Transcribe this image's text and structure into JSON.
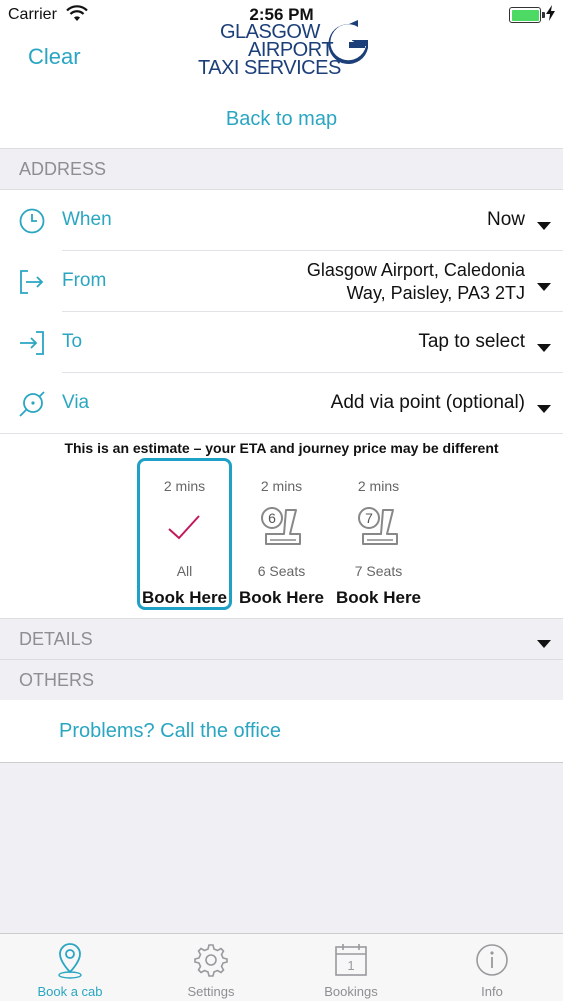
{
  "status_bar": {
    "carrier": "Carrier",
    "time": "2:56 PM"
  },
  "header": {
    "clear_label": "Clear",
    "logo": {
      "line1": "GLASGOW",
      "line2": "AIRPORT",
      "line3": "TAXI SERVICES"
    }
  },
  "back_to_map": "Back to map",
  "sections": {
    "address": "ADDRESS",
    "details": "DETAILS",
    "others": "OTHERS"
  },
  "address_rows": [
    {
      "label": "When",
      "value": "Now",
      "icon": "clock-icon"
    },
    {
      "label": "From",
      "value_line1": "Glasgow Airport, Caledonia",
      "value_line2": "Way, Paisley, PA3 2TJ",
      "icon": "from-icon"
    },
    {
      "label": "To",
      "value": "Tap to select",
      "icon": "to-icon"
    },
    {
      "label": "Via",
      "value": "Add via point (optional)",
      "icon": "via-icon"
    }
  ],
  "estimate_note": "This is an estimate – your ETA and journey price may be different",
  "vehicle_options": [
    {
      "eta": "2 mins",
      "caption": "All",
      "book_label": "Book Here",
      "selected": true
    },
    {
      "eta": "2 mins",
      "caption": "6 Seats",
      "book_label": "Book Here",
      "seat_number": "6"
    },
    {
      "eta": "2 mins",
      "caption": "7 Seats",
      "book_label": "Book Here",
      "seat_number": "7"
    }
  ],
  "problems_label": "Problems? Call the office",
  "tabs": [
    {
      "label": "Book a cab",
      "icon": "location-pin-icon",
      "active": true
    },
    {
      "label": "Settings",
      "icon": "gear-icon"
    },
    {
      "label": "Bookings",
      "icon": "calendar-icon",
      "badge": "1"
    },
    {
      "label": "Info",
      "icon": "info-icon"
    }
  ],
  "colors": {
    "accent": "#2aa6c2",
    "logo_navy": "#1c3f7a",
    "check_magenta": "#c2185b",
    "selected_border": "#1fa0c7"
  }
}
